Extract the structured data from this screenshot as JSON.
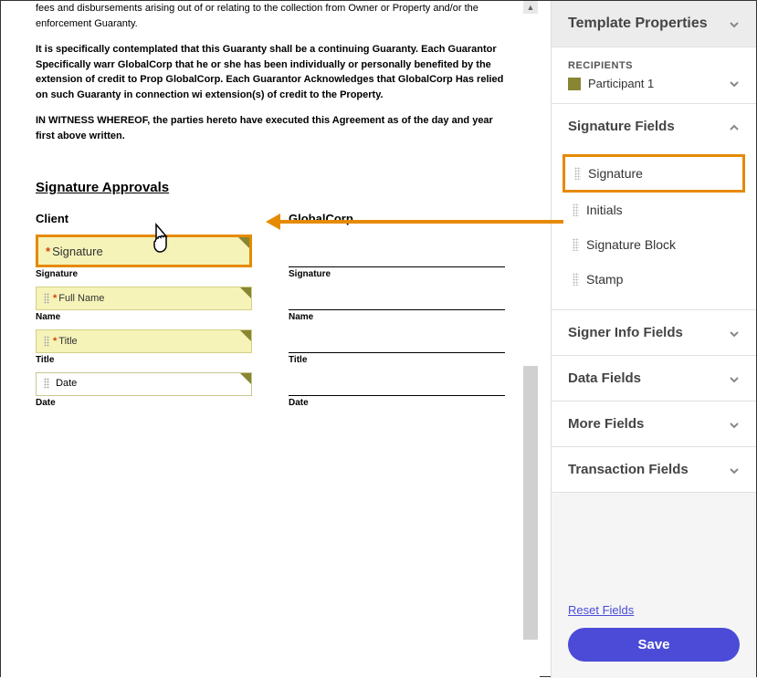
{
  "document": {
    "para1": "fees and disbursements arising out of or relating to the collection from Owner or Property and/or the enforcement Guaranty.",
    "para2": "It is specifically contemplated that this Guaranty shall be a continuing Guaranty. Each Guarantor Specifically warr GlobalCorp that he or she has been individually or personally benefited by the extension of credit to Prop GlobalCorp. Each Guarantor Acknowledges that GlobalCorp Has relied on such Guaranty in connection wi extension(s) of credit to the Property.",
    "para3": "IN WITNESS WHEREOF, the parties hereto have executed this Agreement as of the day and year first above written.",
    "section_title": "Signature Approvals",
    "client_header": "Client",
    "globalcorp_header": "GlobalCorp",
    "labels": {
      "signature": "Signature",
      "name": "Name",
      "title": "Title",
      "date": "Date"
    },
    "placed": {
      "signature": "Signature",
      "full_name": "Full Name",
      "title": "Title",
      "date": "Date"
    }
  },
  "sidebar": {
    "header": "Template Properties",
    "recipients_label": "RECIPIENTS",
    "participant": "Participant 1",
    "sections": {
      "signature_fields": "Signature Fields",
      "signer_info_fields": "Signer Info Fields",
      "data_fields": "Data Fields",
      "more_fields": "More Fields",
      "transaction_fields": "Transaction Fields"
    },
    "signature_items": {
      "signature": "Signature",
      "initials": "Initials",
      "signature_block": "Signature Block",
      "stamp": "Stamp"
    },
    "reset": "Reset Fields",
    "save": "Save"
  }
}
